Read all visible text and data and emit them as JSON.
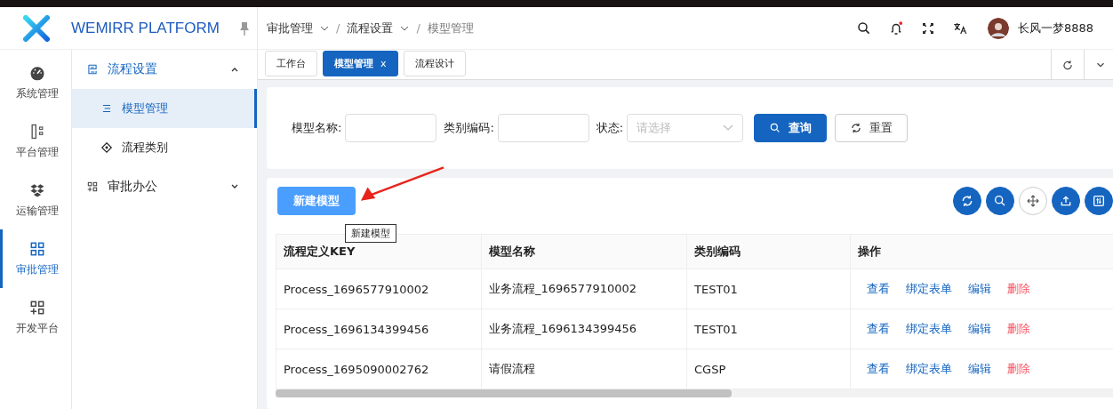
{
  "header": {
    "logo_text": "WEMIRR PLATFORM",
    "breadcrumb": [
      {
        "label": "审批管理",
        "dropdown": true
      },
      {
        "separator": "/",
        "label": "流程设置",
        "dropdown": true
      },
      {
        "separator": "/",
        "label": "模型管理",
        "dropdown": false
      }
    ],
    "notification_dot": true,
    "user_name": "长风一梦8888"
  },
  "rail": [
    {
      "label": "系统管理",
      "selected": false
    },
    {
      "label": "平台管理",
      "selected": false
    },
    {
      "label": "运输管理",
      "selected": false
    },
    {
      "label": "审批管理",
      "selected": true
    },
    {
      "label": "开发平台",
      "selected": false
    }
  ],
  "submenu": [
    {
      "label": "流程设置",
      "expanded": true,
      "children": [
        {
          "label": "模型管理",
          "selected": true
        },
        {
          "label": "流程类别",
          "selected": false
        }
      ]
    },
    {
      "label": "审批办公",
      "expanded": false
    }
  ],
  "tabs": [
    {
      "label": "工作台",
      "selected": false,
      "closable": false
    },
    {
      "label": "模型管理",
      "selected": true,
      "closable": true
    },
    {
      "label": "流程设计",
      "selected": false,
      "closable": false
    }
  ],
  "tab_close": "x",
  "search": {
    "fields": [
      {
        "kind": "input",
        "label": "模型名称:"
      },
      {
        "kind": "input",
        "label": "类别编码:"
      },
      {
        "kind": "select",
        "label": "状态:",
        "placeholder": "请选择"
      }
    ],
    "buttons": [
      {
        "kind": "primary",
        "label": "查询"
      },
      {
        "kind": "default",
        "label": "重置"
      }
    ]
  },
  "toolbar": {
    "new_button": "新建模型",
    "tooltip": "新建模型"
  },
  "table": {
    "columns": [
      "流程定义KEY",
      "模型名称",
      "类别编码",
      "操作"
    ],
    "rows": [
      {
        "cells": [
          "Process_1696577910002",
          "业务流程_1696577910002",
          "TEST01"
        ],
        "actions": [
          {
            "label": "查看",
            "kind": "link"
          },
          {
            "label": "绑定表单",
            "kind": "link"
          },
          {
            "label": "编辑",
            "kind": "link"
          },
          {
            "label": "删除",
            "kind": "danger"
          }
        ]
      },
      {
        "cells": [
          "Process_1696134399456",
          "业务流程_1696134399456",
          "TEST01"
        ],
        "actions": [
          {
            "label": "查看",
            "kind": "link"
          },
          {
            "label": "绑定表单",
            "kind": "link"
          },
          {
            "label": "编辑",
            "kind": "link"
          },
          {
            "label": "删除",
            "kind": "danger"
          }
        ]
      },
      {
        "cells": [
          "Process_1695090002762",
          "请假流程",
          "CGSP"
        ],
        "actions": [
          {
            "label": "查看",
            "kind": "link"
          },
          {
            "label": "绑定表单",
            "kind": "link"
          },
          {
            "label": "编辑",
            "kind": "link"
          },
          {
            "label": "删除",
            "kind": "danger"
          }
        ]
      }
    ]
  },
  "annotation_arrow": true
}
